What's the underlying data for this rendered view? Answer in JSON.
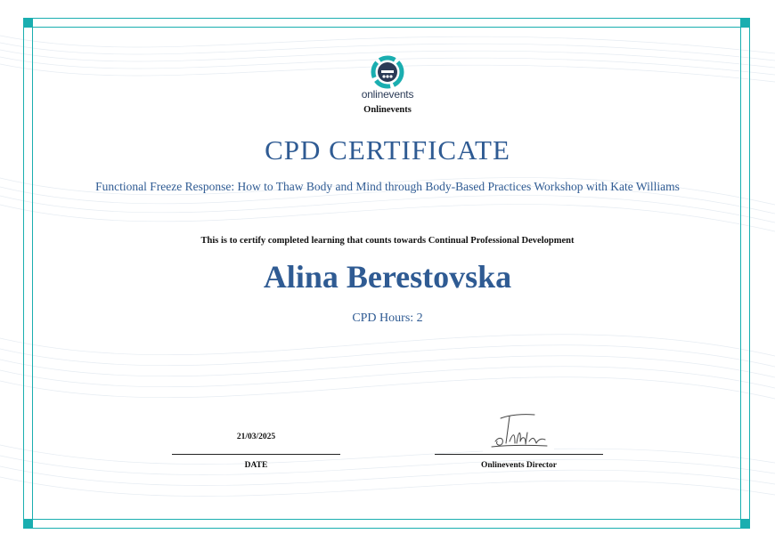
{
  "organization": {
    "logo_word": "onlinevents",
    "name": "Onlinevents"
  },
  "certificate": {
    "title": "CPD CERTIFICATE",
    "course": "Functional Freeze Response: How to Thaw Body and Mind through Body-Based Practices Workshop with Kate Williams",
    "statement": "This is to certify completed learning that counts towards Continual Professional Development",
    "recipient": "Alina Berestovska",
    "hours": "CPD Hours: 2"
  },
  "footer": {
    "date_value": "21/03/2025",
    "date_label": "DATE",
    "signatory_label": "Onlinevents Director"
  },
  "colors": {
    "accent": "#2f5b93",
    "border": "#1aaeb0",
    "text": "#111111"
  }
}
